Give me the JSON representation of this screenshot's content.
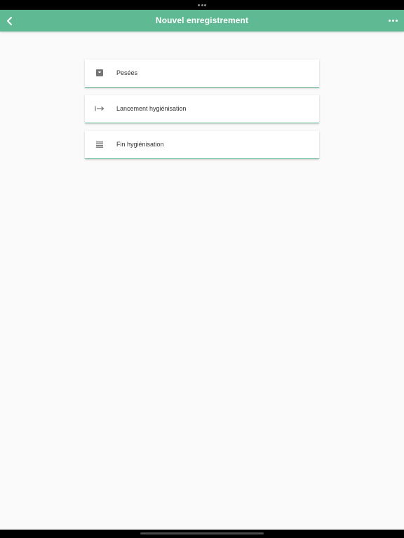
{
  "header": {
    "title": "Nouvel enregistrement",
    "back_icon": "chevron-left-icon",
    "more_icon": "more-horizontal-icon",
    "color": "#5fb993"
  },
  "menu": {
    "items": [
      {
        "label": "Pesées",
        "icon": "scale-icon"
      },
      {
        "label": "Lancement hygiénisation",
        "icon": "arrow-right-from-bar-icon"
      },
      {
        "label": "Fin hygiénisation",
        "icon": "lines-icon"
      }
    ]
  }
}
